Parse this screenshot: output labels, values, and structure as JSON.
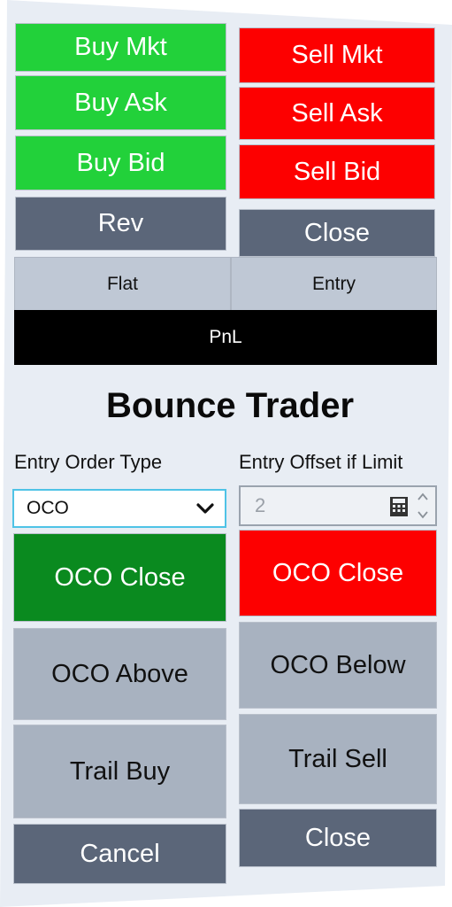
{
  "top_buttons": {
    "buy_mkt": "Buy Mkt",
    "sell_mkt": "Sell Mkt",
    "buy_ask": "Buy Ask",
    "sell_ask": "Sell Ask",
    "buy_bid": "Buy Bid",
    "sell_bid": "Sell Bid",
    "rev": "Rev",
    "close": "Close"
  },
  "position": {
    "status": "Flat",
    "entry": "Entry",
    "pnl": "PnL"
  },
  "bounce": {
    "title": "Bounce Trader",
    "entry_order_type_label": "Entry Order Type",
    "entry_order_type_value": "OCO",
    "entry_offset_label": "Entry Offset if Limit",
    "entry_offset_value": "2",
    "oco_close_buy": "OCO Close",
    "oco_close_sell": "OCO Close",
    "oco_above": "OCO Above",
    "oco_below": "OCO Below",
    "trail_buy": "Trail Buy",
    "trail_sell": "Trail Sell",
    "cancel": "Cancel",
    "close": "Close"
  },
  "icons": {
    "dropdown": "chevron-down-icon",
    "calculator": "calculator-icon",
    "spinner_up": "spinner-up-icon",
    "spinner_down": "spinner-down-icon"
  },
  "colors": {
    "buy": "#22d13a",
    "sell": "#fd0000",
    "neutral": "#5b6679",
    "oco_buy": "#0a8a1f",
    "gray_button": "#a8b2c0"
  }
}
